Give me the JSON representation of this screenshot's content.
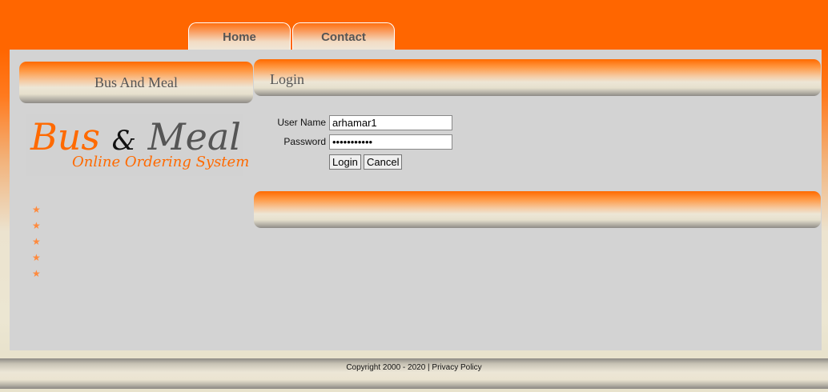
{
  "nav": {
    "tabs": [
      "Home",
      "Contact"
    ]
  },
  "sidebar": {
    "title": "Bus And Meal",
    "logo": {
      "word1": "Bus",
      "amp": "&",
      "word2": "Meal",
      "subtitle": "Online Ordering System"
    },
    "bullets": [
      "★",
      "★",
      "★",
      "★",
      "★"
    ]
  },
  "login": {
    "title": "Login",
    "username_label": "User Name",
    "username_value": "arhamar1",
    "password_label": "Password",
    "password_value": "arhamar1234",
    "login_button": "Login",
    "cancel_button": "Cancel"
  },
  "footer": {
    "copyright": "Copyright 2000 - 2020 | Privacy Policy"
  },
  "colors": {
    "accent": "#ff6600",
    "panel": "#d3d3d3",
    "text": "#555555"
  }
}
